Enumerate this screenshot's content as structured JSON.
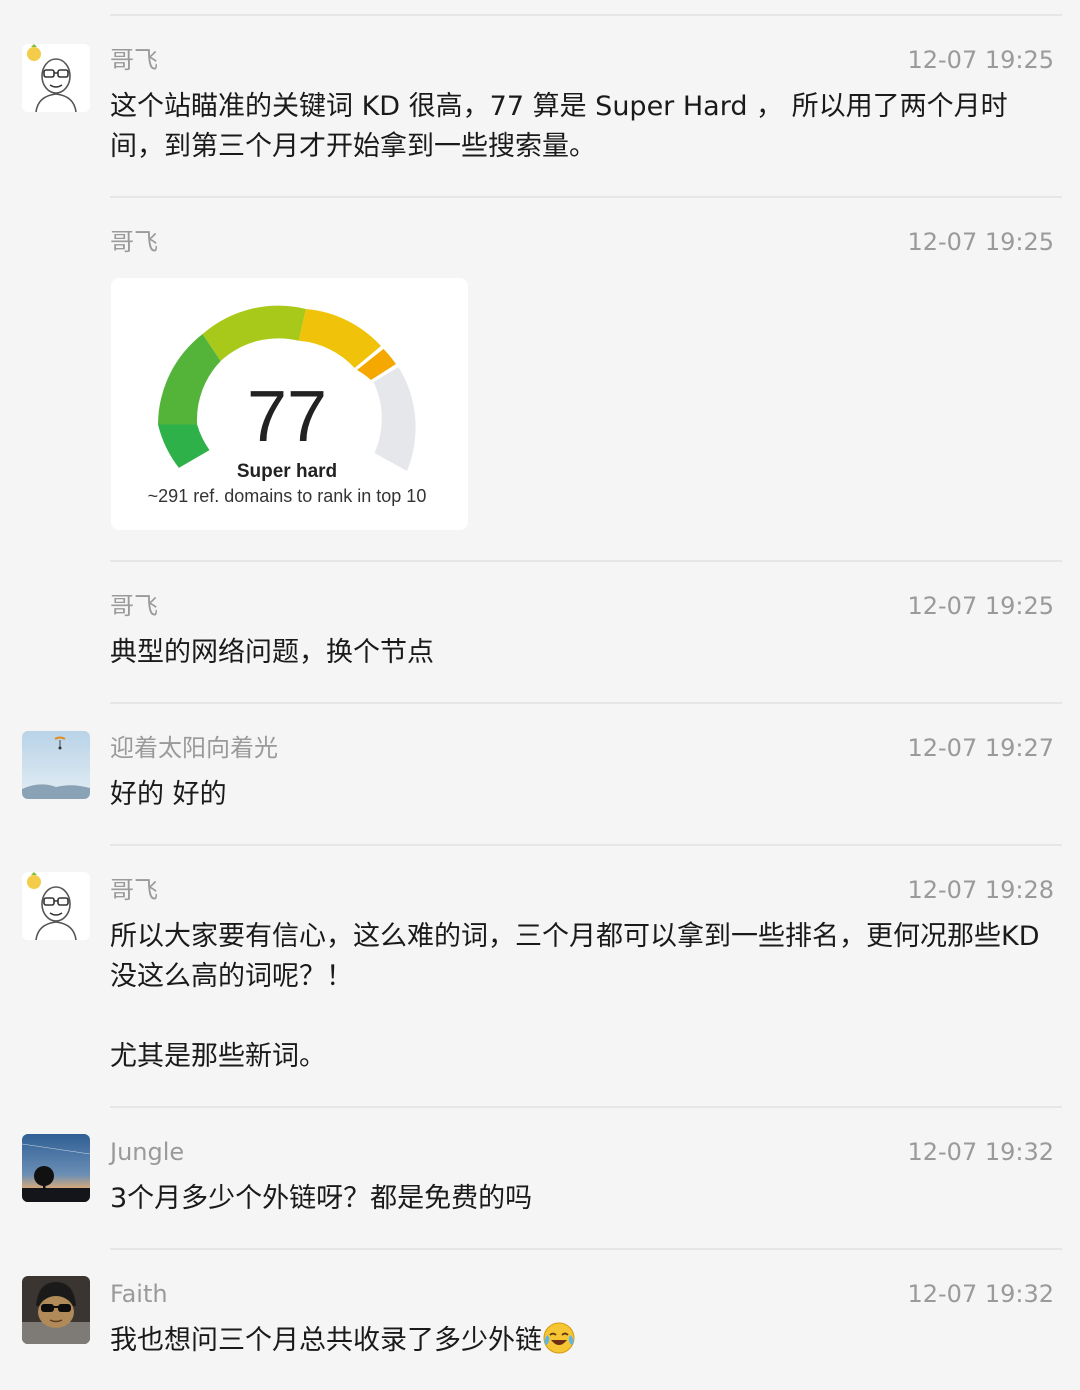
{
  "messages": [
    {
      "name": "哥飞",
      "time": "12-07 19:25",
      "text": "这个站瞄准的关键词 KD 很高，77 算是 Super Hard ， 所以用了两个月时间，到第三个月才开始拿到一些搜索量。"
    },
    {
      "name": "哥飞",
      "time": "12-07 19:25"
    },
    {
      "name": "哥飞",
      "time": "12-07 19:25",
      "text": "典型的网络问题，换个节点"
    },
    {
      "name": "迎着太阳向着光",
      "time": "12-07 19:27",
      "text": "好的 好的"
    },
    {
      "name": "哥飞",
      "time": "12-07 19:28",
      "text": "所以大家要有信心，这么难的词，三个月都可以拿到一些排名，更何况那些KD 没这么高的词呢？！\n\n尤其是那些新词。"
    },
    {
      "name": "Jungle",
      "time": "12-07 19:32",
      "text": "3个月多少个外链呀？都是免费的吗"
    },
    {
      "name": "Faith",
      "time": "12-07 19:32",
      "text": "我也想问三个月总共收录了多少外链"
    }
  ],
  "kd_card": {
    "score": "77",
    "label": "Super hard",
    "subtitle": "~291 ref. domains to rank in top 10",
    "value": 77,
    "max": 100
  },
  "colors": {
    "gauge_green": "#2fb14a",
    "gauge_lime": "#a8c81a",
    "gauge_yellow": "#f0c30a",
    "gauge_orange": "#f5a800",
    "gauge_empty": "#e6e7ea"
  },
  "icons": {
    "avatar_gefei": "bald-man-glasses-avatar-icon",
    "avatar_sun": "sky-parachute-avatar-icon",
    "avatar_jungle": "tree-sunset-avatar-icon",
    "avatar_faith": "sunglasses-person-avatar-icon",
    "emoji": "crying-laughing-emoji-icon"
  }
}
